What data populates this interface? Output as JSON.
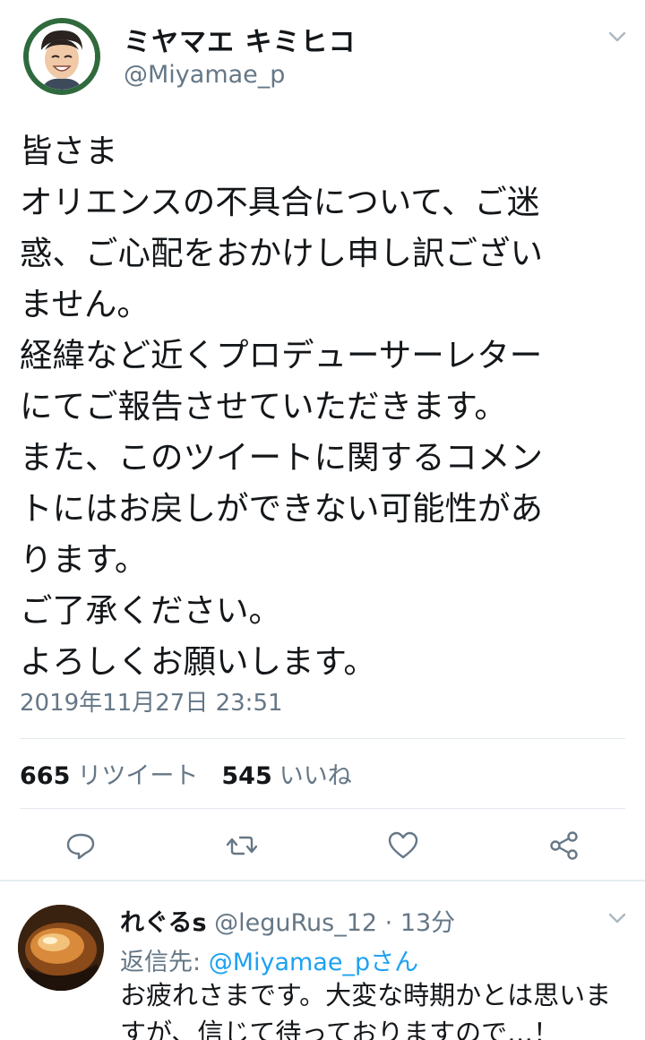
{
  "tweet": {
    "display_name": "ミヤマエ キミヒコ",
    "handle": "@Miyamae_p",
    "text_lines": [
      "皆さま",
      "オリエンスの不具合について、ご迷",
      "惑、ご心配をおかけし申し訳ござい",
      "ません。",
      "経緯など近くプロデューサーレター",
      "にてご報告させていただきます。",
      "また、このツイートに関するコメン",
      "トにはお戻しができない可能性があ",
      "ります。",
      "ご了承ください。",
      "よろしくお願いします。"
    ],
    "timestamp": "2019年11月27日 23:51",
    "retweet_count": "665",
    "retweet_label": "リツイート",
    "like_count": "545",
    "like_label": "いいね"
  },
  "actions": [
    "reply-icon",
    "retweet-icon",
    "like-icon",
    "share-icon"
  ],
  "reply": {
    "name": "れぐるs",
    "handle": "@leguRus_12",
    "time": "13分",
    "replying_to_prefix": "返信先: ",
    "replying_to_mention": "@Miyamae_p",
    "replying_to_suffix": "さん",
    "text_lines": [
      "お疲れさまです。大変な時期かとは思いま",
      "すが、信じて待っておりますので…！"
    ]
  },
  "colors": {
    "text": "#14171a",
    "secondary": "#657786",
    "accent": "#1da1f2",
    "divider": "#e1e8ed"
  }
}
